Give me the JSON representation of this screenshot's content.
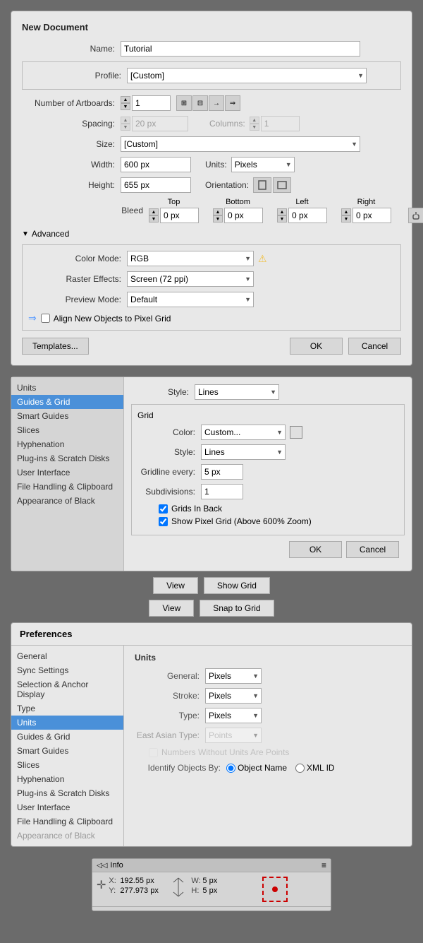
{
  "newDocument": {
    "title": "New Document",
    "nameLabel": "Name:",
    "nameValue": "Tutorial",
    "profileLabel": "Profile:",
    "profileValue": "[Custom]",
    "artboardsLabel": "Number of Artboards:",
    "artboardsValue": "1",
    "spacingLabel": "Spacing:",
    "spacingValue": "20 px",
    "columnsLabel": "Columns:",
    "columnsValue": "1",
    "sizeLabel": "Size:",
    "sizeValue": "[Custom]",
    "widthLabel": "Width:",
    "widthValue": "600 px",
    "heightLabel": "Height:",
    "heightValue": "655 px",
    "unitsLabel": "Units:",
    "unitsValue": "Pixels",
    "orientationLabel": "Orientation:",
    "bleedLabel": "Bleed",
    "bleedTopLabel": "Top",
    "bleedBottomLabel": "Bottom",
    "bleedLeftLabel": "Left",
    "bleedRightLabel": "Right",
    "bleedTop": "0 px",
    "bleedBottom": "0 px",
    "bleedLeft": "0 px",
    "bleedRight": "0 px",
    "advancedLabel": "Advanced",
    "colorModeLabel": "Color Mode:",
    "colorModeValue": "RGB",
    "rasterLabel": "Raster Effects:",
    "rasterValue": "Screen (72 ppi)",
    "previewLabel": "Preview Mode:",
    "previewValue": "Default",
    "alignLabel": "Align New Objects to Pixel Grid",
    "templatesBtn": "Templates...",
    "okBtn": "OK",
    "cancelBtn": "Cancel"
  },
  "guidesGrid": {
    "guidesStyleLabel": "Style:",
    "guidesStyleValue": "Lines",
    "gridSectionTitle": "Grid",
    "colorLabel": "Color:",
    "colorValue": "Custom...",
    "styleLabel": "Style:",
    "styleValue": "Lines",
    "gridlineLabel": "Gridline every:",
    "gridlineValue": "5 px",
    "subdivisionsLabel": "Subdivisions:",
    "subdivisionsValue": "1",
    "gridsInBackLabel": "Grids In Back",
    "showPixelGridLabel": "Show Pixel Grid (Above 600% Zoom)",
    "okBtn": "OK",
    "cancelBtn": "Cancel"
  },
  "prefsSidebarItems": [
    "Units",
    "Guides & Grid",
    "Smart Guides",
    "Slices",
    "Hyphenation",
    "Plug-ins & Scratch Disks",
    "User Interface",
    "File Handling & Clipboard",
    "Appearance of Black"
  ],
  "viewButtons": [
    {
      "label": "View",
      "action": "Show Grid"
    },
    {
      "label": "View",
      "action": "Snap to Grid"
    }
  ],
  "prefsDialog": {
    "title": "Preferences",
    "sidebarItems": [
      "General",
      "Sync Settings",
      "Selection & Anchor Display",
      "Type",
      "Units",
      "Guides & Grid",
      "Smart Guides",
      "Slices",
      "Hyphenation",
      "Plug-ins & Scratch Disks",
      "User Interface",
      "File Handling & Clipboard",
      "Appearance of Black"
    ],
    "activeItem": "Units",
    "contentTitle": "Units",
    "generalLabel": "General:",
    "generalValue": "Pixels",
    "strokeLabel": "Stroke:",
    "strokeValue": "Pixels",
    "typeLabel": "Type:",
    "typeValue": "Pixels",
    "eastAsianLabel": "East Asian Type:",
    "eastAsianValue": "Points",
    "eastAsianDisabled": true,
    "numbersLabel": "Numbers Without Units Are Points",
    "identifyLabel": "Identify Objects By:",
    "objectNameLabel": "Object Name",
    "xmlIdLabel": "XML ID"
  },
  "infoPanel": {
    "title": "Info",
    "xLabel": "X:",
    "xValue": "192.55 px",
    "yLabel": "Y:",
    "yValue": "277.973 px",
    "wLabel": "W:",
    "wValue": "5 px",
    "hLabel": "H:",
    "hValue": "5 px"
  }
}
